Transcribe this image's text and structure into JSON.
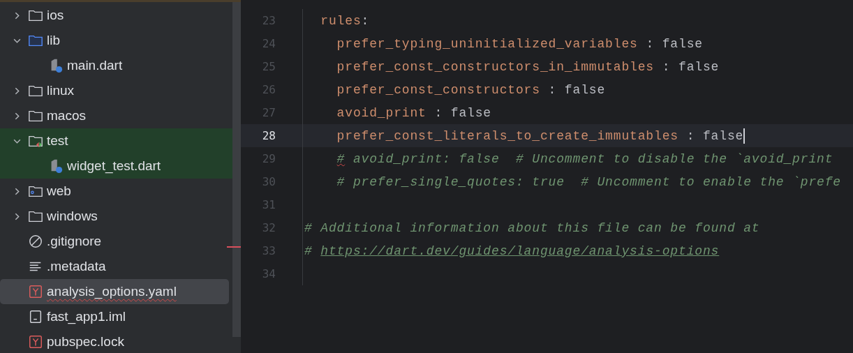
{
  "project_tree": [
    {
      "label": "ios",
      "kind": "folder",
      "expanded": false,
      "selected": false,
      "tinted": false,
      "error": false
    },
    {
      "label": "lib",
      "kind": "source-folder",
      "expanded": true,
      "selected": false,
      "tinted": false,
      "error": false,
      "children": [
        {
          "label": "main.dart",
          "kind": "dart",
          "selected": false,
          "tinted": false,
          "error": false
        }
      ]
    },
    {
      "label": "linux",
      "kind": "folder",
      "expanded": false,
      "selected": false,
      "tinted": false,
      "error": false
    },
    {
      "label": "macos",
      "kind": "folder",
      "expanded": false,
      "selected": false,
      "tinted": false,
      "error": false
    },
    {
      "label": "test",
      "kind": "test-folder",
      "expanded": true,
      "selected": false,
      "tinted": true,
      "error": false,
      "children": [
        {
          "label": "widget_test.dart",
          "kind": "dart",
          "selected": false,
          "tinted": true,
          "error": false
        }
      ]
    },
    {
      "label": "web",
      "kind": "web-folder",
      "expanded": false,
      "selected": false,
      "tinted": false,
      "error": false
    },
    {
      "label": "windows",
      "kind": "folder",
      "expanded": false,
      "selected": false,
      "tinted": false,
      "error": false
    },
    {
      "label": ".gitignore",
      "kind": "ignore",
      "selected": false,
      "tinted": false,
      "error": false
    },
    {
      "label": ".metadata",
      "kind": "text",
      "selected": false,
      "tinted": false,
      "error": false
    },
    {
      "label": "analysis_options.yaml",
      "kind": "yaml",
      "selected": true,
      "tinted": false,
      "error": true
    },
    {
      "label": "fast_app1.iml",
      "kind": "iml",
      "selected": false,
      "tinted": false,
      "error": false
    },
    {
      "label": "pubspec.lock",
      "kind": "yaml",
      "selected": false,
      "tinted": false,
      "error": false
    }
  ],
  "editor": {
    "lines": [
      {
        "number": "23",
        "current": false,
        "tokens": [
          {
            "kind": "key",
            "text": "  rules"
          },
          {
            "kind": "plain",
            "text": ":"
          }
        ]
      },
      {
        "number": "24",
        "current": false,
        "tokens": [
          {
            "kind": "key",
            "text": "    prefer_typing_uninitialized_variables"
          },
          {
            "kind": "plain",
            "text": " : false"
          }
        ]
      },
      {
        "number": "25",
        "current": false,
        "tokens": [
          {
            "kind": "key",
            "text": "    prefer_const_constructors_in_immutables"
          },
          {
            "kind": "plain",
            "text": " : false"
          }
        ]
      },
      {
        "number": "26",
        "current": false,
        "tokens": [
          {
            "kind": "key",
            "text": "    prefer_const_constructors"
          },
          {
            "kind": "plain",
            "text": " : false"
          }
        ]
      },
      {
        "number": "27",
        "current": false,
        "tokens": [
          {
            "kind": "key",
            "text": "    avoid_print"
          },
          {
            "kind": "plain",
            "text": " : false"
          }
        ]
      },
      {
        "number": "28",
        "current": true,
        "tokens": [
          {
            "kind": "key",
            "text": "    prefer_const_literals_to_create_immutables"
          },
          {
            "kind": "plain",
            "text": " : false"
          }
        ]
      },
      {
        "number": "29",
        "current": false,
        "tokens": [
          {
            "kind": "typo",
            "text": "    #"
          },
          {
            "kind": "comment",
            "text": " avoid_print: false  # Uncomment to disable the `avoid_print"
          }
        ]
      },
      {
        "number": "30",
        "current": false,
        "tokens": [
          {
            "kind": "comment",
            "text": "    # prefer_single_quotes: true  # Uncomment to enable the `prefe"
          }
        ]
      },
      {
        "number": "31",
        "current": false
      },
      {
        "number": "32",
        "current": false,
        "tokens": [
          {
            "kind": "comment",
            "text": "# Additional information about this file can be found at"
          }
        ]
      },
      {
        "number": "33",
        "current": false,
        "tokens": [
          {
            "kind": "comment",
            "text": "# "
          },
          {
            "kind": "link",
            "text": "https://dart.dev/guides/language/analysis-options"
          }
        ]
      },
      {
        "number": "34",
        "current": false
      }
    ]
  }
}
